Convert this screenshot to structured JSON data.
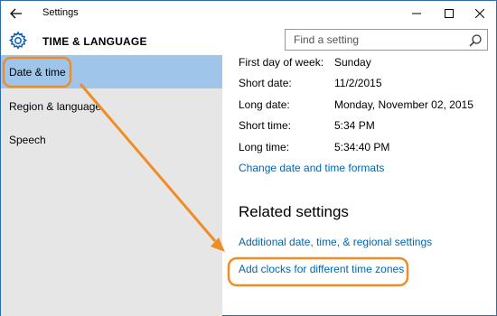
{
  "window": {
    "title": "Settings"
  },
  "header": {
    "section_title": "TIME & LANGUAGE",
    "search_placeholder": "Find a setting"
  },
  "sidebar": {
    "items": [
      {
        "label": "Date & time",
        "selected": true
      },
      {
        "label": "Region & language",
        "selected": false
      },
      {
        "label": "Speech",
        "selected": false
      }
    ]
  },
  "formats": [
    {
      "label": "First day of week:",
      "value": "Sunday"
    },
    {
      "label": "Short date:",
      "value": "11/2/2015"
    },
    {
      "label": "Long date:",
      "value": "Monday, November 02, 2015"
    },
    {
      "label": "Short time:",
      "value": "5:34 PM"
    },
    {
      "label": "Long time:",
      "value": "5:34:40 PM"
    }
  ],
  "links": {
    "change_formats": "Change date and time formats",
    "related_heading": "Related settings",
    "additional": "Additional date, time, & regional settings",
    "add_clocks": "Add clocks for different time zones"
  },
  "colors": {
    "accent": "#0066b4",
    "selected_bg": "#9fc6ea",
    "sidebar_bg": "#e6e6e6",
    "annotation": "#f08c24"
  }
}
